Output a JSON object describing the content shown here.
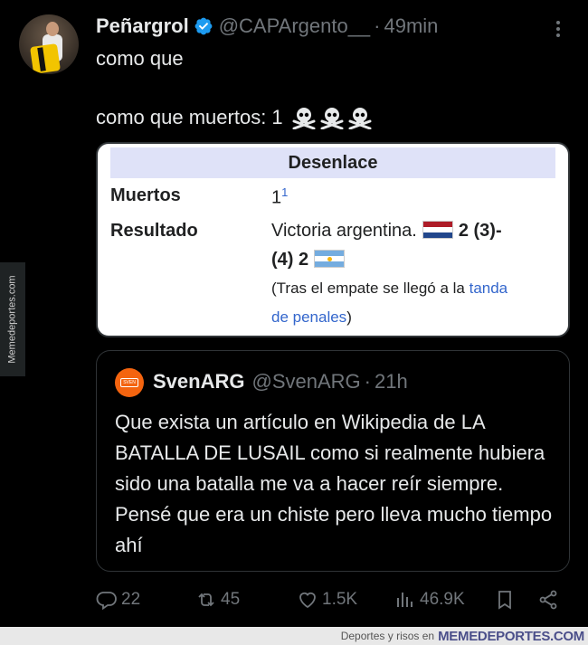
{
  "tweet": {
    "author_name": "Peñargrol",
    "handle": "@CAPArgento__",
    "separator": "·",
    "time": "49min",
    "line1": "como que",
    "line2": "como que muertos: 1"
  },
  "wiki": {
    "header": "Desenlace",
    "rows": [
      {
        "label": "Muertos",
        "value": "1",
        "sup": "1"
      },
      {
        "label": "Resultado",
        "value_prefix": "Victoria argentina.",
        "score_a": "2 (3)-",
        "score_b": "(4) 2"
      }
    ],
    "note_prefix": "(Tras el empate se llegó a la ",
    "note_link1": "tanda",
    "note_link2": "de penales",
    "note_suffix": ")"
  },
  "quote": {
    "author_name": "SvenARG",
    "handle": "@SvenARG",
    "separator": "·",
    "time": "21h",
    "avatar_text": "SVEN",
    "text": "Que exista un artículo en Wikipedia de LA BATALLA DE LUSAIL como si realmente hubiera sido una batalla me va a hacer reír siempre. Pensé que era un chiste pero lleva mucho tiempo ahí"
  },
  "actions": {
    "replies": "22",
    "retweets": "45",
    "likes": "1.5K",
    "views": "46.9K"
  },
  "watermark": {
    "side": "Memedeportes.com",
    "footer_small": "Deportes y risos en",
    "footer_brand": "MEMEDEPORTES.COM"
  },
  "colors": {
    "background": "#000000",
    "muted": "#71767b",
    "verified": "#1d9bf0",
    "wiki_header": "#dfe2f8",
    "wiki_link": "#3366cc"
  },
  "icons": [
    "verified-badge-icon",
    "more-icon",
    "skull-crossbones-icon",
    "reply-icon",
    "retweet-icon",
    "like-icon",
    "views-icon",
    "bookmark-icon",
    "share-icon"
  ]
}
